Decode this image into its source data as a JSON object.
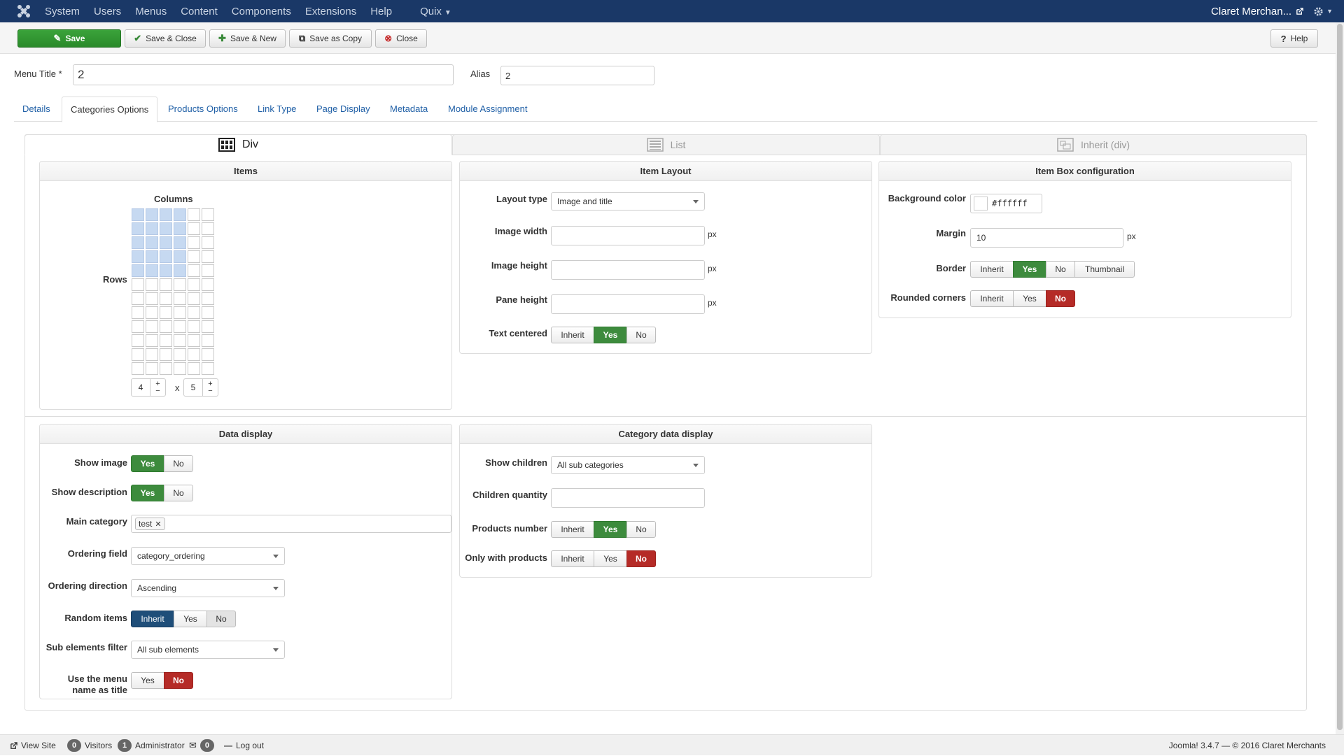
{
  "navbar": {
    "menu": [
      "System",
      "Users",
      "Menus",
      "Content",
      "Components",
      "Extensions",
      "Help",
      "Quix"
    ],
    "user": "Claret Merchan..."
  },
  "toolbar": {
    "save": "Save",
    "save_close": "Save & Close",
    "save_new": "Save & New",
    "save_copy": "Save as Copy",
    "close": "Close",
    "help": "Help"
  },
  "form": {
    "menu_title_label": "Menu Title *",
    "menu_title_value": "2",
    "alias_label": "Alias",
    "alias_value": "2"
  },
  "tabs": [
    "Details",
    "Categories Options",
    "Products Options",
    "Link Type",
    "Page Display",
    "Metadata",
    "Module Assignment"
  ],
  "layout_tabs": [
    "Div",
    "List",
    "Inherit (div)"
  ],
  "items_panel": {
    "title": "Items",
    "columns_label": "Columns",
    "rows_label": "Rows",
    "columns": "4",
    "rows": "5",
    "times": "x",
    "plus": "+",
    "minus": "−"
  },
  "item_layout": {
    "title": "Item Layout",
    "layout_type_label": "Layout type",
    "layout_type_value": "Image and title",
    "image_width_label": "Image width",
    "image_height_label": "Image height",
    "pane_height_label": "Pane height",
    "unit": "px",
    "text_centered_label": "Text centered",
    "opt_inherit": "Inherit",
    "opt_yes": "Yes",
    "opt_no": "No"
  },
  "item_box": {
    "title": "Item Box configuration",
    "bg_color_label": "Background color",
    "bg_color_value": "#ffffff",
    "margin_label": "Margin",
    "margin_value": "10",
    "unit": "px",
    "border_label": "Border",
    "thumbnail": "Thumbnail",
    "rounded_label": "Rounded corners",
    "opt_inherit": "Inherit",
    "opt_yes": "Yes",
    "opt_no": "No"
  },
  "data_display": {
    "title": "Data display",
    "show_image_label": "Show image",
    "show_desc_label": "Show description",
    "main_category_label": "Main category",
    "main_category_tag": "test",
    "ordering_field_label": "Ordering field",
    "ordering_field_value": "category_ordering",
    "ordering_dir_label": "Ordering direction",
    "ordering_dir_value": "Ascending",
    "random_label": "Random items",
    "sub_filter_label": "Sub elements filter",
    "sub_filter_value": "All sub elements",
    "menu_name_label_1": "Use the menu",
    "menu_name_label_2": "name as title",
    "opt_inherit": "Inherit",
    "opt_yes": "Yes",
    "opt_no": "No"
  },
  "category_data": {
    "title": "Category data display",
    "show_children_label": "Show children",
    "show_children_value": "All sub categories",
    "children_qty_label": "Children quantity",
    "products_number_label": "Products number",
    "only_products_label": "Only with products",
    "opt_inherit": "Inherit",
    "opt_yes": "Yes",
    "opt_no": "No"
  },
  "footer": {
    "view_site": "View Site",
    "visitors_count": "0",
    "visitors": "Visitors",
    "admin_count": "1",
    "administrator": "Administrator",
    "messages_count": "0",
    "logout": "Log out",
    "copyright": "Joomla! 3.4.7 — © 2016 Claret Merchants"
  },
  "colors": {
    "navbar": "#1a3867",
    "active_green": "#3d8b3d",
    "active_red": "#b52b27",
    "active_blue": "#1f4e79"
  }
}
